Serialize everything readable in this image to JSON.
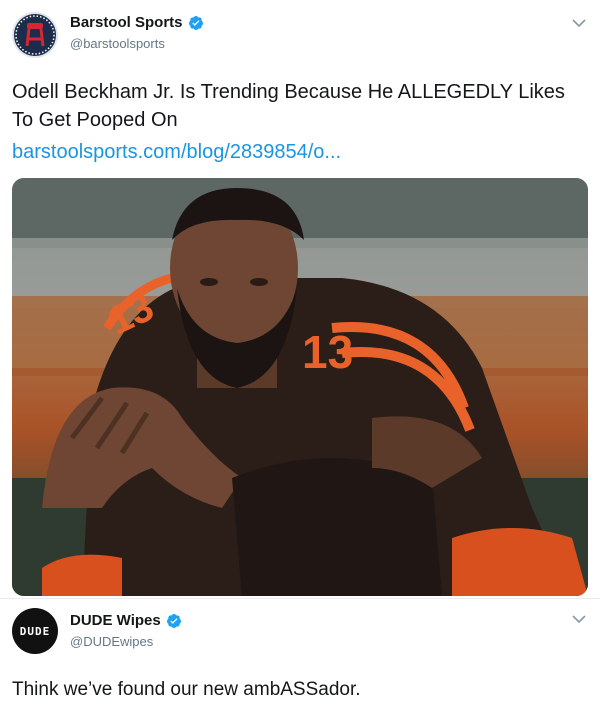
{
  "tweets": [
    {
      "author": {
        "name": "Barstool Sports",
        "handle": "@barstoolsports",
        "avatar_icon": "barstool-logo",
        "verified": true
      },
      "text": "Odell Beckham Jr. Is Trending Because He ALLEGEDLY Likes To Get Pooped On",
      "link": "barstoolsports.com/blog/2839854/o...",
      "media": {
        "jersey_number": "13",
        "colors": {
          "jersey": "#2b1d18",
          "stripe": "#e8622a"
        }
      }
    },
    {
      "author": {
        "name": "DUDE Wipes",
        "handle": "@DUDEwipes",
        "avatar_text": "DUDE",
        "verified": true
      },
      "text": "Think we’ve found our new ambASSador."
    }
  ],
  "colors": {
    "verified_blue": "#1da1f2",
    "link_blue": "#1b95e0",
    "handle_gray": "#657786"
  }
}
